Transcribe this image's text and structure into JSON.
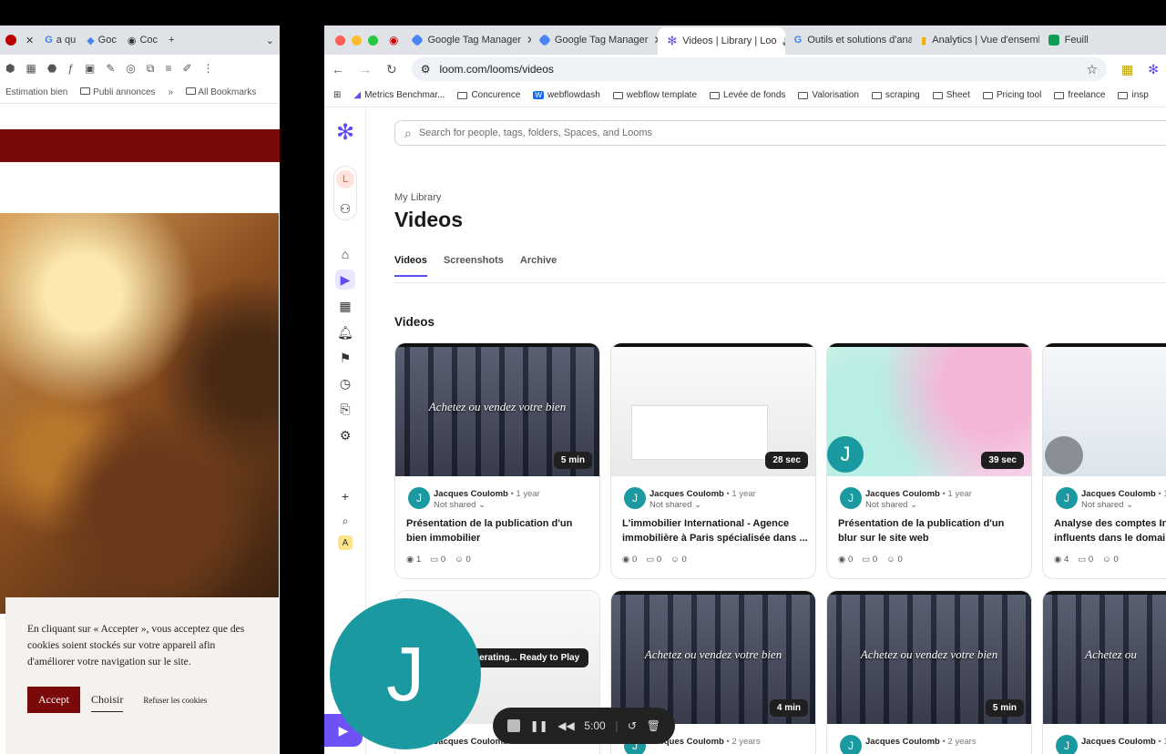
{
  "left_window": {
    "tabs": [
      "a qu",
      "Goc",
      "Coc"
    ],
    "bookmarks": [
      "Estimation bien",
      "Publi annonces",
      "»",
      "All Bookmarks"
    ],
    "cookie": {
      "text": "En cliquant sur « Accepter », vous acceptez que des cookies soient stockés sur votre appareil afin d'améliorer votre navigation sur le site.",
      "accept": "Accept",
      "choose": "Choisir",
      "refuse": "Refuser les cookies"
    }
  },
  "browser": {
    "tabs": [
      {
        "label": "Google Tag Manager",
        "color": "#4a86f2"
      },
      {
        "label": "Google Tag Manager",
        "color": "#4a86f2"
      },
      {
        "label": "Videos | Library | Loo",
        "color": "#5f4df0"
      },
      {
        "label": "Outils et solutions d'ana",
        "color": "#ea4335"
      },
      {
        "label": "Analytics | Vue d'ensemb",
        "color": "#f9ab00"
      },
      {
        "label": "Feuill",
        "color": "#0f9d58"
      }
    ],
    "url": "loom.com/looms/videos",
    "bookmarks": [
      "Metrics Benchmar...",
      "Concurence",
      "webflowdash",
      "webflow template",
      "Levée de fonds",
      "Valorisation",
      "scraping",
      "Sheet",
      "Pricing tool",
      "freelance",
      "insp"
    ]
  },
  "loom": {
    "search_placeholder": "Search for people, tags, folders, Spaces, and Looms",
    "user_initial": "L",
    "breadcrumb": "My Library",
    "title": "Videos",
    "tabs": [
      "Videos",
      "Screenshots",
      "Archive"
    ],
    "section": "Videos",
    "cards": [
      {
        "thumb_text": "Achetez ou vendez votre bien",
        "duration": "5 min",
        "author": "Jacques Coulomb",
        "age": "• 1 year",
        "share": "Not shared",
        "title": "Présentation de la publication d'un bien immobilier",
        "views": "1",
        "comments": "0",
        "reactions": "0"
      },
      {
        "thumb_text": "",
        "duration": "28 sec",
        "author": "Jacques Coulomb",
        "age": "• 1 year",
        "share": "Not shared",
        "title": "L'immobilier International - Agence immobilière à Paris spécialisée dans ...",
        "views": "0",
        "comments": "0",
        "reactions": "0"
      },
      {
        "thumb_text": "",
        "duration": "39 sec",
        "author": "Jacques Coulomb",
        "age": "• 1 year",
        "share": "Not shared",
        "title": "Présentation de la publication d'un blur sur le site web",
        "views": "0",
        "comments": "0",
        "reactions": "0"
      },
      {
        "thumb_text": "",
        "duration": "",
        "author": "Jacques Coulomb",
        "age": "• 1",
        "share": "Not shared",
        "title": "Analyse des comptes In influents dans le domain",
        "views": "4",
        "comments": "0",
        "reactions": "0"
      }
    ],
    "row2": [
      {
        "duration": "",
        "author": "Jacques Coulomb",
        "age": "",
        "pill": "nerating... Ready to Play"
      },
      {
        "thumb_text": "Achetez ou vendez votre bien",
        "duration": "4 min",
        "author": "Jacques Coulomb",
        "age": "• 2 years"
      },
      {
        "thumb_text": "Achetez ou vendez votre bien",
        "duration": "5 min",
        "author": "Jacques Coulomb",
        "age": "• 2 years"
      },
      {
        "thumb_text": "Achetez ou",
        "duration": "",
        "author": "Jacques Coulomb",
        "age": "• 1"
      }
    ],
    "card_avatar": "J",
    "big_avatar": "J",
    "recorder_time": "5:00"
  }
}
